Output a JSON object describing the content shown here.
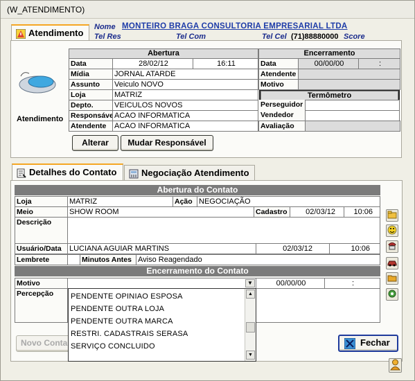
{
  "window": {
    "title": "(W_ATENDIMENTO)"
  },
  "header": {
    "nome_label": "Nome",
    "nome_value": "MONTEIRO BRAGA CONSULTORIA EMPRESARIAL LTDA",
    "telres_label": "Tel Res",
    "telcom_label": "Tel Com",
    "telcel_label": "Tel Cel",
    "telcel_value": "(71)88880000",
    "score_label": "Score"
  },
  "tabs_top": {
    "atendimento": "Atendimento"
  },
  "atendimento": {
    "icon_caption": "Atendimento",
    "abertura_title": "Abertura",
    "encerramento_title": "Encerramento",
    "termometro_title": "Termômetro",
    "labels": {
      "data": "Data",
      "midia": "Mídia",
      "assunto": "Assunto",
      "loja": "Loja",
      "depto": "Depto.",
      "responsavel": "Responsável",
      "atendente": "Atendente",
      "enc_data": "Data",
      "enc_atendente": "Atendente",
      "enc_motivo": "Motivo",
      "perseguidor": "Perseguidor",
      "vendedor": "Vendedor",
      "avaliacao": "Avaliação"
    },
    "values": {
      "data": "28/02/12",
      "hora": "16:11",
      "midia": "JORNAL ATARDE",
      "assunto": "Veiculo NOVO",
      "loja": "MATRIZ",
      "depto": "VEICULOS NOVOS",
      "responsavel": "ACAO INFORMATICA",
      "atendente": "ACAO INFORMATICA",
      "enc_data": "00/00/00",
      "enc_hora": ":"
    },
    "buttons": {
      "alterar": "Alterar",
      "mudar": "Mudar Responsável"
    }
  },
  "tabs_bottom": {
    "detalhes": "Detalhes do Contato",
    "negociacao": "Negociação Atendimento"
  },
  "contato": {
    "abertura_title": "Abertura do Contato",
    "encerramento_title": "Encerramento do Contato",
    "labels": {
      "loja": "Loja",
      "acao": "Ação",
      "meio": "Meio",
      "cadastro": "Cadastro",
      "descricao": "Descrição",
      "usuario": "Usuário/Data",
      "lembrete": "Lembrete",
      "minutos": "Minutos Antes",
      "motivo": "Motivo",
      "percepcao": "Percepção"
    },
    "values": {
      "loja": "MATRIZ",
      "acao": "NEGOCIAÇÃO",
      "meio": "SHOW ROOM",
      "cad_data": "02/03/12",
      "cad_hora": "10:06",
      "usuario": "LUCIANA AGUIAR MARTINS",
      "usu_data": "02/03/12",
      "usu_hora": "10:06",
      "minutos": "Aviso Reagendado",
      "enc_data": "00/00/00",
      "enc_hora": ":"
    },
    "motivo_options": [
      "PENDENTE OPINIAO ESPOSA",
      "PENDENTE OUTRA LOJA",
      "PENDENTE OUTRA MARCA",
      "RESTRI. CADASTRAIS SERASA",
      "SERVIÇO CONCLUIDO"
    ]
  },
  "footer": {
    "novo": "Novo Conta",
    "fechar": "Fechar"
  }
}
